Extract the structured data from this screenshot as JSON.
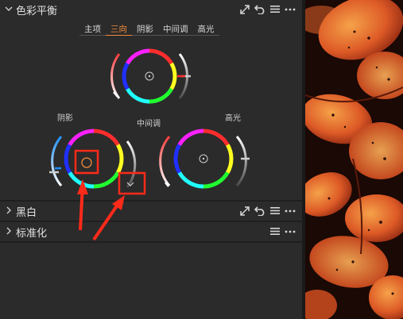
{
  "panel": {
    "section_color_balance": {
      "title": "色彩平衡"
    },
    "tabs": [
      {
        "label": "主项",
        "active": false
      },
      {
        "label": "三向",
        "active": true
      },
      {
        "label": "阴影",
        "active": false
      },
      {
        "label": "中间调",
        "active": false
      },
      {
        "label": "高光",
        "active": false
      }
    ],
    "wheels": {
      "shadow_label": "阴影",
      "midtone_label": "中间调",
      "highlight_label": "高光"
    },
    "section_bw": {
      "title": "黑白"
    },
    "section_normalize": {
      "title": "标准化"
    }
  },
  "icons": {
    "expand": "expand-icon",
    "reset": "reset-icon",
    "menu": "menu-icon",
    "more": "more-icon"
  },
  "colors": {
    "accent_orange": "#f28a3a",
    "annotation_red": "#ff2a1a",
    "panel_bg": "#2b2b2b"
  }
}
